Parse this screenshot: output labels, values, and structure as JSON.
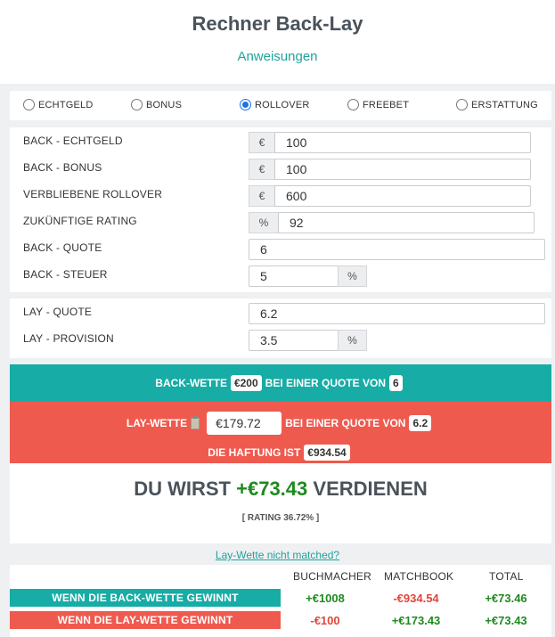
{
  "header": {
    "title": "Rechner Back-Lay",
    "instructions_link": "Anweisungen"
  },
  "bet_types": [
    {
      "label": "ECHTGELD",
      "selected": false
    },
    {
      "label": "BONUS",
      "selected": false
    },
    {
      "label": "ROLLOVER",
      "selected": true
    },
    {
      "label": "FREEBET",
      "selected": false
    },
    {
      "label": "ERSTATTUNG",
      "selected": false
    }
  ],
  "back": {
    "echtgeld_label": "BACK - ECHTGELD",
    "echtgeld_addon": "€",
    "echtgeld_value": "100",
    "bonus_label": "BACK - BONUS",
    "bonus_addon": "€",
    "bonus_value": "100",
    "rollover_label": "VERBLIEBENE ROLLOVER",
    "rollover_addon": "€",
    "rollover_value": "600",
    "rating_label": "ZUKÜNFTIGE RATING",
    "rating_addon": "%",
    "rating_value": "92",
    "quote_label": "BACK - QUOTE",
    "quote_value": "6",
    "tax_label": "BACK - STEUER",
    "tax_value": "5",
    "tax_addon": "%"
  },
  "lay": {
    "quote_label": "LAY - QUOTE",
    "quote_value": "6.2",
    "commission_label": "LAY - PROVISION",
    "commission_value": "3.5",
    "commission_addon": "%"
  },
  "back_bet": {
    "prefix": "BACK-WETTE",
    "stake": "€200",
    "middle": "BEI EINER QUOTE VON",
    "odds": "6"
  },
  "lay_bet": {
    "prefix": "LAY-WETTE",
    "stake": "€179.72",
    "middle": "BEI EINER QUOTE VON",
    "odds": "6.2",
    "liability_label": "DIE HAFTUNG IST",
    "liability": "€934.54"
  },
  "result": {
    "prefix": "DU WIRST",
    "amount": "+€73.43",
    "suffix": "VERDIENEN",
    "rating": "[ RATING 36.72% ]"
  },
  "not_matched_link": "Lay-Wette nicht matched?",
  "table": {
    "headers": [
      "BUCHMACHER",
      "MATCHBOOK",
      "TOTAL"
    ],
    "rows": [
      {
        "label": "WENN DIE BACK-WETTE GEWINNT",
        "bookmaker": "+€1008",
        "matchbook": "-€934.54",
        "total": "+€73.46"
      },
      {
        "label": "WENN DIE LAY-WETTE GEWINNT",
        "bookmaker": "-€100",
        "matchbook": "+€173.43",
        "total": "+€73.43"
      }
    ]
  },
  "colors": {
    "teal": "#17aca5",
    "red": "#ef5a4f",
    "green": "#1e8a1e"
  },
  "icons": {
    "clipboard": "clipboard-icon"
  }
}
